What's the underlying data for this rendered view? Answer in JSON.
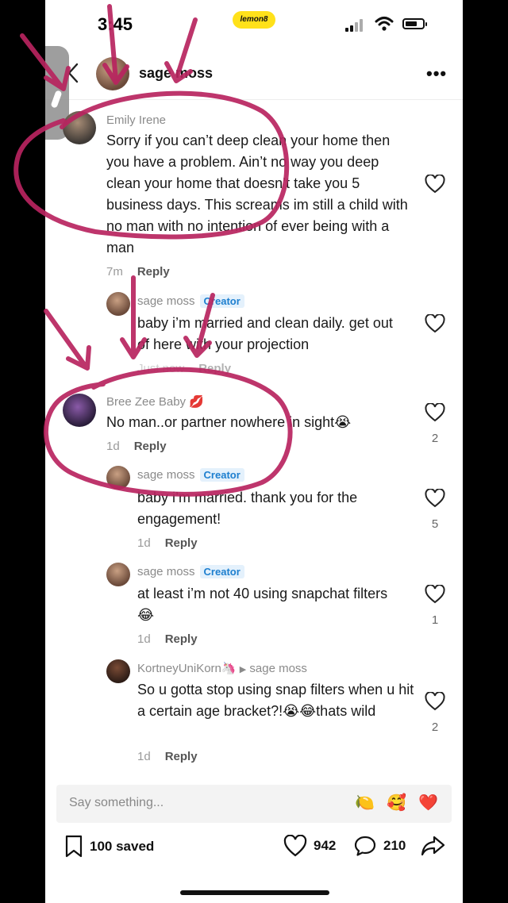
{
  "status_bar": {
    "time": "3:45",
    "app_badge": "lemon8"
  },
  "header": {
    "profile_name": "sage moss",
    "more_label": "•••"
  },
  "creator_badge": "Creator",
  "comments": [
    {
      "name": "Emily Irene",
      "text": "Sorry if you can’t deep clean your home then you have a problem. Ain’t no way you deep clean your home that doesn’t take you 5 business days. This screams im still a child with no man with no intention of ever being with a man",
      "time": "7m",
      "reply_label": "Reply",
      "likes": ""
    },
    {
      "name": "sage moss",
      "text": "baby i’m married and clean daily. get out of here with your projection",
      "time": "Just now",
      "reply_label": "Reply",
      "likes": ""
    },
    {
      "name": "Bree Zee Baby 💋",
      "text": "No man..or partner nowhere in sight😭",
      "time": "1d",
      "reply_label": "Reply",
      "likes": "2"
    },
    {
      "name": "sage moss",
      "text": "baby i’m married. thank you for the engagement!",
      "time": "1d",
      "reply_label": "Reply",
      "likes": "5"
    },
    {
      "name": "sage moss",
      "text": "at least i’m not 40 using snapchat filters 😂",
      "time": "1d",
      "reply_label": "Reply",
      "likes": "1"
    },
    {
      "name": "KortneyUniKorn🦄",
      "reply_to": "sage moss",
      "text": "So u gotta stop using snap filters when u hit a certain age bracket?!😭😂thats wild",
      "time": "1d",
      "reply_label": "Reply",
      "likes": "2"
    }
  ],
  "input": {
    "placeholder": "Say something...",
    "emojis": [
      "🍋",
      "🥰",
      "❤️"
    ]
  },
  "bottom_bar": {
    "saved_label": "100 saved",
    "likes": "942",
    "comments": "210"
  },
  "icons": {
    "bookmark": "bookmark-icon",
    "heart": "heart-icon",
    "comment": "comment-icon",
    "share": "share-icon",
    "back": "chevron-left-icon"
  },
  "colors": {
    "annotation": "#b8245f",
    "creator_badge": "#1e7fcf",
    "app_badge": "#ffe11a"
  }
}
